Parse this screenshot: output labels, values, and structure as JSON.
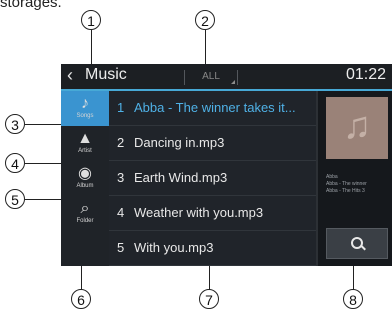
{
  "caption": "storages.",
  "callouts": [
    "1",
    "2",
    "3",
    "4",
    "5",
    "6",
    "7",
    "8"
  ],
  "header": {
    "back_glyph": "‹",
    "title": "Music",
    "filter": "ALL",
    "time": "01:22"
  },
  "sidebar": [
    {
      "label": "Songs",
      "icon": "music-note-icon",
      "glyph": "♪"
    },
    {
      "label": "Artist",
      "icon": "person-icon",
      "glyph": "▲"
    },
    {
      "label": "Album",
      "icon": "disc-icon",
      "glyph": "◉"
    },
    {
      "label": "Folder",
      "icon": "folder-search-icon",
      "glyph": "⌕"
    }
  ],
  "tracks": [
    {
      "num": "1",
      "title": "Abba - The winner takes it..."
    },
    {
      "num": "2",
      "title": "Dancing in.mp3"
    },
    {
      "num": "3",
      "title": "Earth Wind.mp3"
    },
    {
      "num": "4",
      "title": "Weather with you.mp3"
    },
    {
      "num": "5",
      "title": "With you.mp3"
    }
  ],
  "now_playing": {
    "art_glyph": "♫",
    "artist": "Abba",
    "album": "Abba - The winner",
    "extra": "Abba - The Hits 3"
  },
  "colors": {
    "accent": "#3a94d0",
    "playing_text": "#4fb1e6",
    "screen_bg": "#1c2026"
  }
}
